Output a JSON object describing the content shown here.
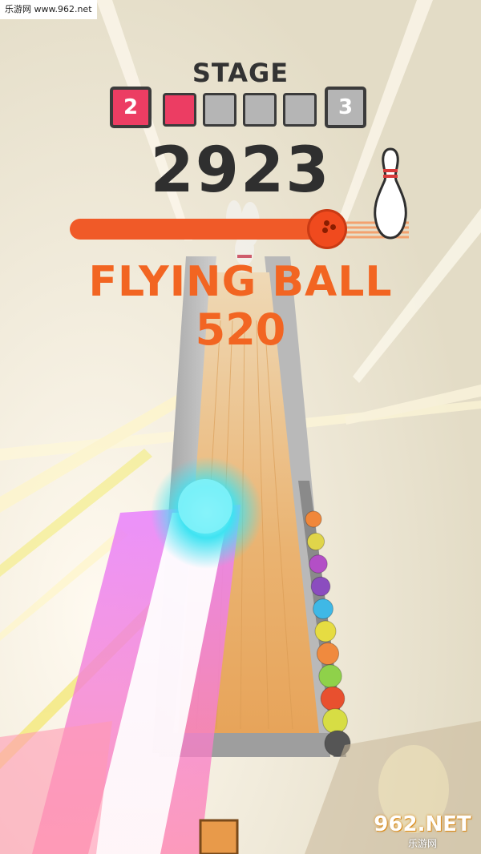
{
  "watermark": {
    "top_text": "乐游网 www.962.net",
    "logo_text": "962.NET",
    "logo_sub": "乐游网"
  },
  "hud": {
    "stage_label": "STAGE",
    "current_stage": "2",
    "next_stage": "3",
    "stage_progress": {
      "completed_segments": 1,
      "total_segments": 4
    },
    "score": "2923",
    "level_progress": 0.93
  },
  "bonus": {
    "label": "FLYING BALL",
    "value": "520"
  },
  "colors": {
    "stage_current": "#ec3d63",
    "stage_next": "#b5b5b5",
    "accent_orange": "#f26522",
    "lane": "#e8b06a",
    "ball_glow": "#3fe3f2"
  },
  "ball_rack": {
    "ball_colors": [
      "#f0873a",
      "#e0d54a",
      "#b34fc6",
      "#8b4dbf",
      "#3fb8e6",
      "#e6dc42",
      "#f08a3e",
      "#8fd14a",
      "#e8502f",
      "#d7dd44",
      "#555555"
    ]
  },
  "icons": {
    "pin": "bowling-pin-icon",
    "progress_ball": "bowling-ball-icon"
  }
}
